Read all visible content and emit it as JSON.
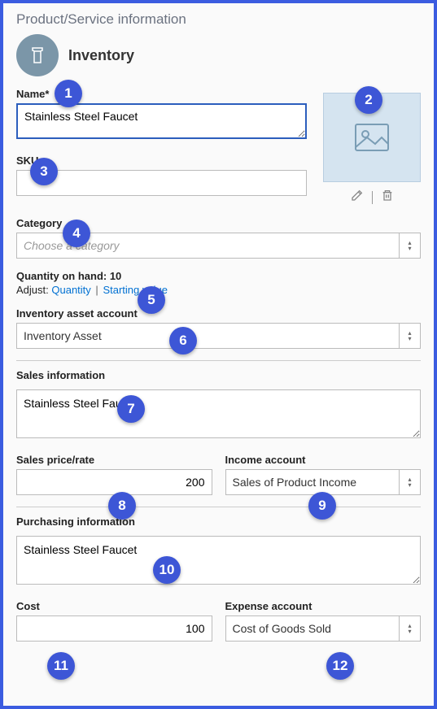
{
  "title": "Product/Service information",
  "header": "Inventory",
  "name": {
    "label": "Name*",
    "value": "Stainless Steel Faucet"
  },
  "sku": {
    "label": "SKU",
    "value": ""
  },
  "category": {
    "label": "Category",
    "placeholder": "Choose a category"
  },
  "qty": {
    "label_text": "Quantity on hand: 10",
    "adjust_label": "Adjust:",
    "quantity_link": "Quantity",
    "starting_link": "Starting value"
  },
  "asset": {
    "label": "Inventory asset account",
    "value": "Inventory Asset"
  },
  "sales": {
    "label": "Sales information",
    "desc": "Stainless Steel Faucet",
    "price_label": "Sales price/rate",
    "price_value": "200",
    "income_label": "Income account",
    "income_value": "Sales of Product Income"
  },
  "purchasing": {
    "label": "Purchasing information",
    "desc": "Stainless Steel Faucet",
    "cost_label": "Cost",
    "cost_value": "100",
    "expense_label": "Expense account",
    "expense_value": "Cost of Goods Sold"
  },
  "markers": {
    "1": "1",
    "2": "2",
    "3": "3",
    "4": "4",
    "5": "5",
    "6": "6",
    "7": "7",
    "8": "8",
    "9": "9",
    "10": "10",
    "11": "11",
    "12": "12"
  }
}
